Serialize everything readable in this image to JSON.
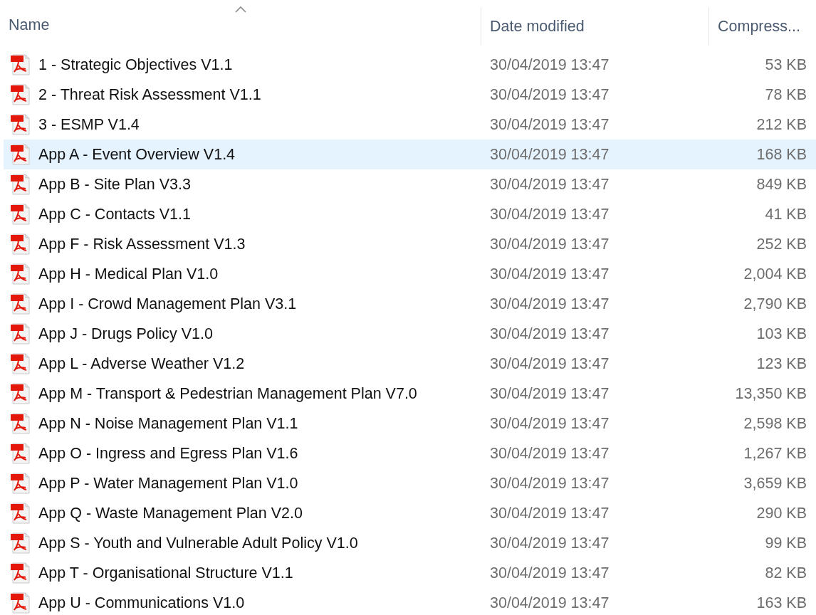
{
  "columns": [
    {
      "label": "Name",
      "sorted": true
    },
    {
      "label": "Date modified",
      "sorted": false
    },
    {
      "label": "Compress...",
      "sorted": false
    }
  ],
  "rows": [
    {
      "name": "1 - Strategic Objectives V1.1",
      "date": "30/04/2019 13:47",
      "size": "53 KB",
      "selected": false
    },
    {
      "name": "2 - Threat Risk Assessment V1.1",
      "date": "30/04/2019 13:47",
      "size": "78 KB",
      "selected": false
    },
    {
      "name": "3 - ESMP V1.4",
      "date": "30/04/2019 13:47",
      "size": "212 KB",
      "selected": false
    },
    {
      "name": "App A - Event Overview V1.4",
      "date": "30/04/2019 13:47",
      "size": "168 KB",
      "selected": true
    },
    {
      "name": "App B - Site Plan V3.3",
      "date": "30/04/2019 13:47",
      "size": "849 KB",
      "selected": false
    },
    {
      "name": "App C - Contacts V1.1",
      "date": "30/04/2019 13:47",
      "size": "41 KB",
      "selected": false
    },
    {
      "name": "App F - Risk Assessment V1.3",
      "date": "30/04/2019 13:47",
      "size": "252 KB",
      "selected": false
    },
    {
      "name": "App H - Medical Plan V1.0",
      "date": "30/04/2019 13:47",
      "size": "2,004 KB",
      "selected": false
    },
    {
      "name": "App I - Crowd Management Plan V3.1",
      "date": "30/04/2019 13:47",
      "size": "2,790 KB",
      "selected": false
    },
    {
      "name": "App J - Drugs Policy V1.0",
      "date": "30/04/2019 13:47",
      "size": "103 KB",
      "selected": false
    },
    {
      "name": "App L - Adverse Weather V1.2",
      "date": "30/04/2019 13:47",
      "size": "123 KB",
      "selected": false
    },
    {
      "name": "App M - Transport & Pedestrian Management Plan V7.0",
      "date": "30/04/2019 13:47",
      "size": "13,350 KB",
      "selected": false
    },
    {
      "name": "App N - Noise Management Plan V1.1",
      "date": "30/04/2019 13:47",
      "size": "2,598 KB",
      "selected": false
    },
    {
      "name": "App O - Ingress and Egress Plan V1.6",
      "date": "30/04/2019 13:47",
      "size": "1,267 KB",
      "selected": false
    },
    {
      "name": "App P - Water Management Plan V1.0",
      "date": "30/04/2019 13:47",
      "size": "3,659 KB",
      "selected": false
    },
    {
      "name": "App Q - Waste Management Plan V2.0",
      "date": "30/04/2019 13:47",
      "size": "290 KB",
      "selected": false
    },
    {
      "name": "App S - Youth and Vulnerable Adult Policy V1.0",
      "date": "30/04/2019 13:47",
      "size": "99 KB",
      "selected": false
    },
    {
      "name": "App T - Organisational Structure V1.1",
      "date": "30/04/2019 13:47",
      "size": "82 KB",
      "selected": false
    },
    {
      "name": "App U - Communications V1.0",
      "date": "30/04/2019 13:47",
      "size": "163 KB",
      "selected": false
    }
  ]
}
